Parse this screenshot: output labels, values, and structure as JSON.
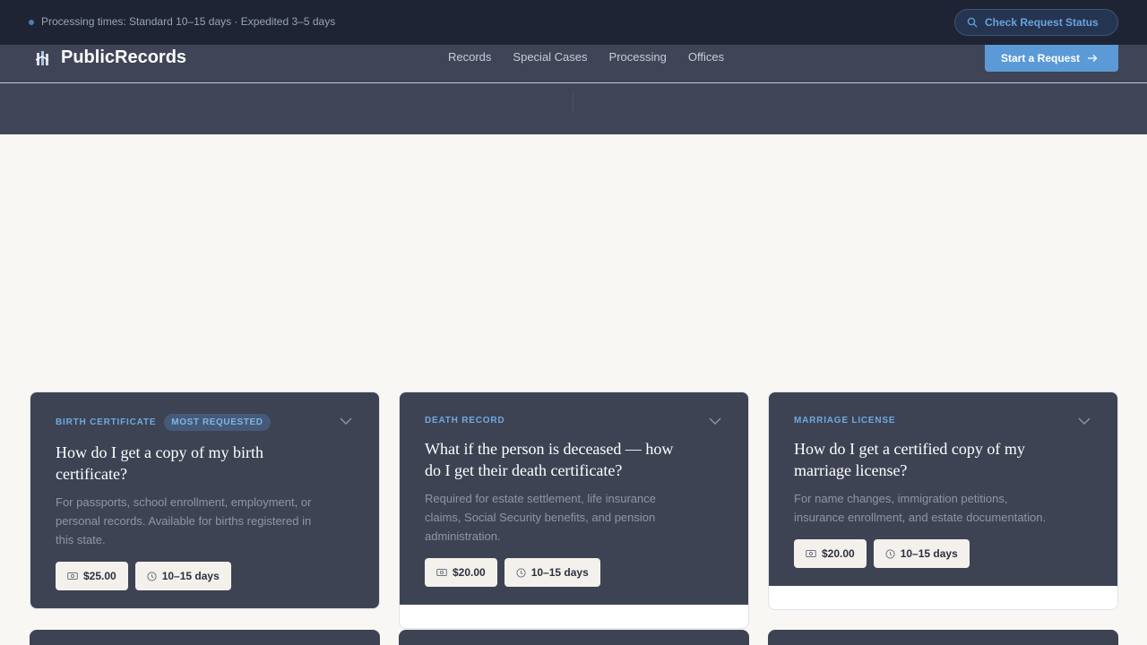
{
  "topbar": {
    "processing_text": "Processing times: Standard 10–15 days · Expedited 3–5 days",
    "status_button": "Check Request Status"
  },
  "navbar": {
    "logo": "PublicRecords",
    "links": [
      "Records",
      "Special Cases",
      "Processing",
      "Offices"
    ],
    "start_button": "Start a Request"
  },
  "cards": [
    {
      "tag": "BIRTH CERTIFICATE",
      "badge": "MOST REQUESTED",
      "title": "How do I get a copy of my birth certificate?",
      "description": "For passports, school enrollment, employment, or personal records. Available for births registered in this state.",
      "fee": "$25.00",
      "time": "10–15 days"
    },
    {
      "tag": "DEATH RECORD",
      "title": "What if the person is deceased — how do I get their death certificate?",
      "description": "Required for estate settlement, life insurance claims, Social Security benefits, and pension administration.",
      "fee": "$20.00",
      "time": "10–15 days"
    },
    {
      "tag": "MARRIAGE LICENSE",
      "title": "How do I get a certified copy of my marriage license?",
      "description": "For name changes, immigration petitions, insurance enrollment, and estate documentation.",
      "fee": "$20.00",
      "time": "10–15 days"
    }
  ],
  "colors": {
    "topbar_bg": "#1e2433",
    "nav_bg": "#3f4556",
    "accent": "#5b9ad7",
    "card_bg": "#3d4353",
    "page_bg": "#f8f7f4"
  },
  "icons": [
    "records-logo-icon",
    "search-icon",
    "arrow-right-icon",
    "chevron-down-icon",
    "money-icon",
    "clock-icon"
  ]
}
